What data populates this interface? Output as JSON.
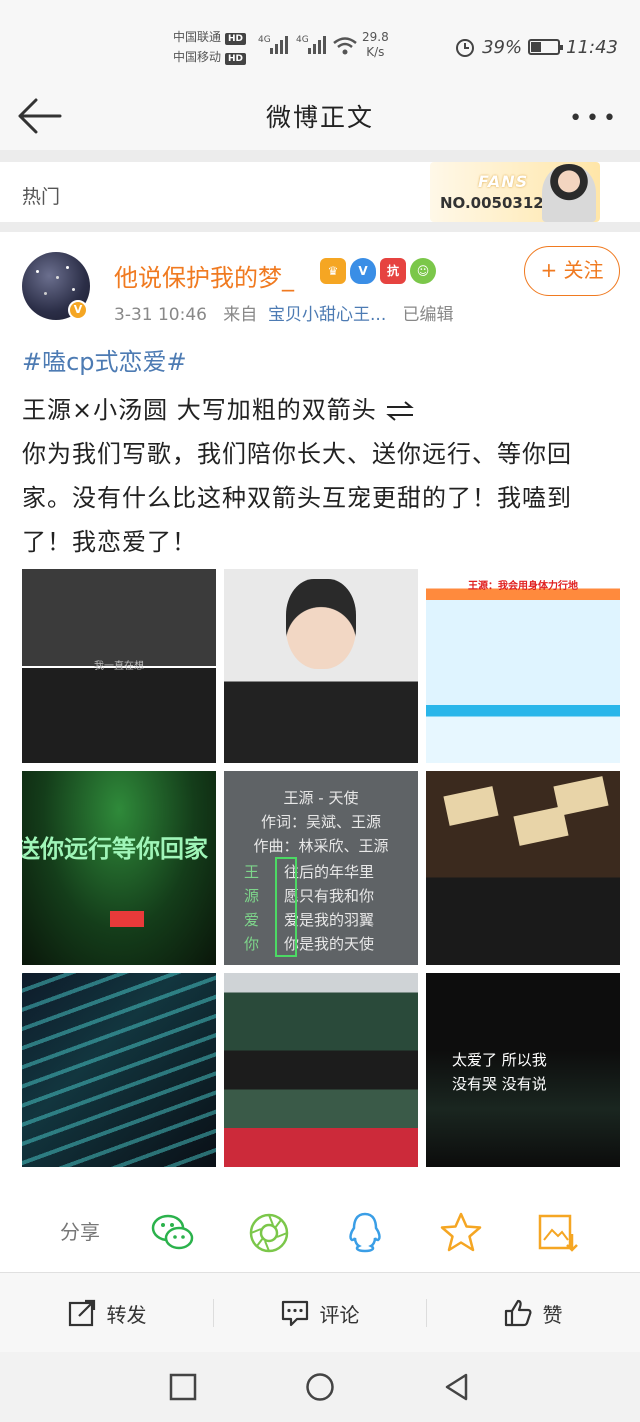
{
  "status_bar": {
    "carrier1": "中国联通",
    "carrier2": "中国移动",
    "hd": "HD",
    "net1": "4G",
    "net2": "4G",
    "speed_value": "29.8",
    "speed_unit": "K/s",
    "battery_percent": "39%",
    "battery_level": 0.39,
    "time": "11:43"
  },
  "header": {
    "title": "微博正文"
  },
  "hot": {
    "label": "热门",
    "fans_title": "FANS",
    "fans_number": "NO.0050312"
  },
  "post": {
    "username": "他说保护我的梦_",
    "badges": [
      "♛",
      "V",
      "抗",
      "☺"
    ],
    "time": "3-31 10:46",
    "from_label": "来自",
    "source": "宝贝小甜心王...",
    "edited": "已编辑",
    "follow_label": "+ 关注",
    "topic": "#嗑cp式恋爱#",
    "text_line1": "王源×小汤圆 大写加粗的双箭头",
    "text_rest": "你为我们写歌，我们陪你长大、送你远行、等你回家。没有什么比这种双箭头互宠更甜的了！我嗑到了！我恋爱了！"
  },
  "photos": {
    "p1_sub": "我一直在想",
    "p3_banner": "王源：我会用身体力行地",
    "p4_text": "送你远行等你回家",
    "p5_title": "王源 - 天使",
    "p5_lyricist": "作词：吴斌、王源",
    "p5_composer": "作曲：林采欣、王源",
    "p5_lyrics": [
      {
        "side": "王",
        "text": "往后的年华里"
      },
      {
        "side": "源",
        "text": "愿只有我和你"
      },
      {
        "side": "爱",
        "text": "爱是我的羽翼"
      },
      {
        "side": "你",
        "text": "你是我的天使"
      }
    ],
    "p9_line1": "太爱了  所以我",
    "p9_line2": "没有哭  没有说"
  },
  "share": {
    "label": "分享",
    "icons": [
      "wechat-icon",
      "moments-icon",
      "qq-icon",
      "favorite-icon",
      "save-image-icon"
    ],
    "colors": {
      "wechat": "#2bb24c",
      "moments": "#7bc74a",
      "qq": "#3a9ee6",
      "favorite": "#f5a623",
      "save": "#f5a623"
    }
  },
  "actions": {
    "repost": "转发",
    "comment": "评论",
    "like": "赞"
  }
}
